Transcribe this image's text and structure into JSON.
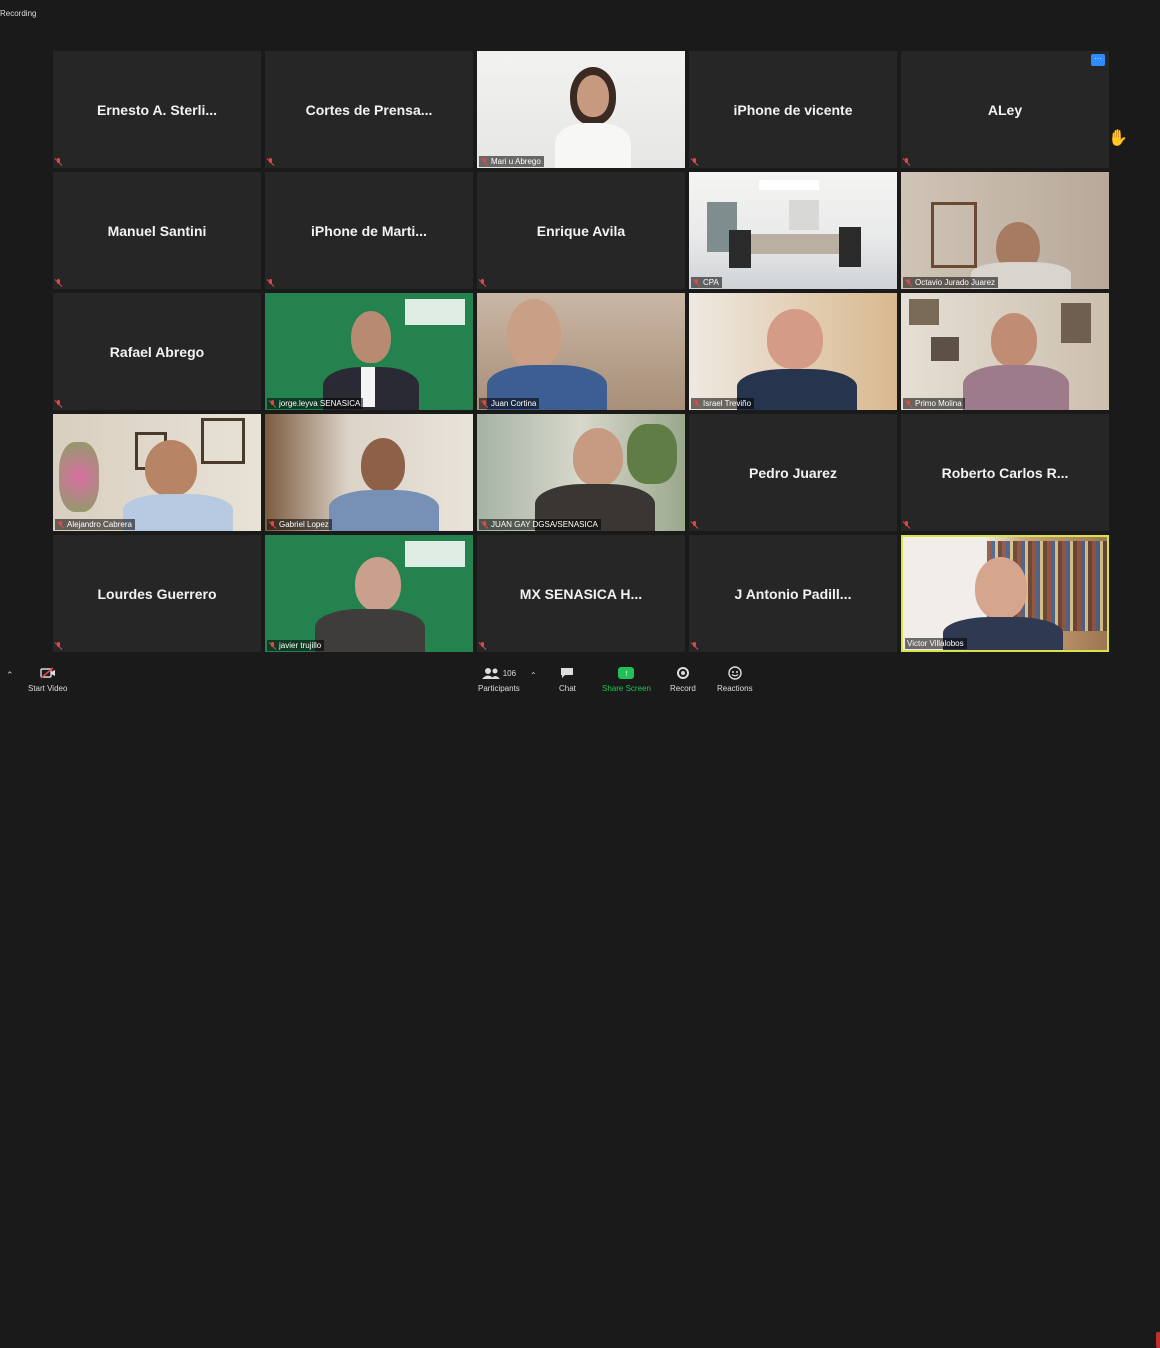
{
  "recording_label": "Recording",
  "participants": [
    {
      "name": "Ernesto A. Sterli...",
      "type": "name"
    },
    {
      "name": "Cortes de Prensa...",
      "type": "name"
    },
    {
      "name": "Mari u Abrego",
      "type": "video"
    },
    {
      "name": "iPhone de vicente",
      "type": "name"
    },
    {
      "name": "ALey",
      "type": "name"
    },
    {
      "name": "Manuel Santini",
      "type": "name"
    },
    {
      "name": "iPhone de Marti...",
      "type": "name"
    },
    {
      "name": "Enrique Avila",
      "type": "name"
    },
    {
      "name": "CPA",
      "type": "video"
    },
    {
      "name": "Octavio Jurado Juarez",
      "type": "video"
    },
    {
      "name": "Rafael Abrego",
      "type": "name"
    },
    {
      "name": "jorge.leyva SENASICA",
      "type": "video"
    },
    {
      "name": "Juan Cortina",
      "type": "video"
    },
    {
      "name": "Israel Treviño",
      "type": "video"
    },
    {
      "name": "Primo Molina",
      "type": "video"
    },
    {
      "name": "Alejandro Cabrera",
      "type": "video"
    },
    {
      "name": "Gabriel Lopez",
      "type": "video"
    },
    {
      "name": "JUAN GAY DGSA/SENASICA",
      "type": "video"
    },
    {
      "name": "Pedro Juarez",
      "type": "name"
    },
    {
      "name": "Roberto Carlos R...",
      "type": "name"
    },
    {
      "name": "Lourdes Guerrero",
      "type": "name"
    },
    {
      "name": "javier trujillo",
      "type": "video"
    },
    {
      "name": "MX SENASICA H...",
      "type": "name"
    },
    {
      "name": "J Antonio Padill...",
      "type": "name"
    },
    {
      "name": "Victor Villalobos",
      "type": "video",
      "active_speaker": true
    }
  ],
  "toolbar": {
    "start_video": "Start Video",
    "participants_label": "Participants",
    "participants_count": "106",
    "chat": "Chat",
    "share_screen": "Share Screen",
    "record": "Record",
    "reactions": "Reactions"
  },
  "colors": {
    "active_speaker_border": "#d6e34a",
    "share_green": "#21c157",
    "mute_red": "#e24646"
  }
}
